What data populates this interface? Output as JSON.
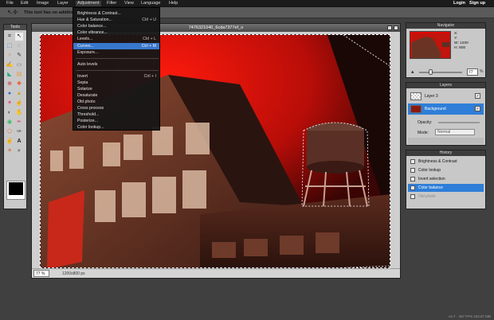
{
  "menubar": {
    "items": [
      "File",
      "Edit",
      "Image",
      "Layer",
      "Adjustment",
      "Filter",
      "View",
      "Language",
      "Help"
    ],
    "login": "Login",
    "signup": "Sign up"
  },
  "optbar": {
    "message": "This tool has no additional options."
  },
  "tools": {
    "title": "Tools"
  },
  "document": {
    "title": "7476321040_6cda7377ef_o",
    "zoom": "77",
    "zoom_unit": "%",
    "dimensions": "1200x800 px"
  },
  "adjustment_menu": {
    "items": [
      {
        "label": "Brightness & Contrast...",
        "shortcut": ""
      },
      {
        "label": "Hue & Saturation...",
        "shortcut": "Ctrl + U"
      },
      {
        "label": "Color balance...",
        "shortcut": ""
      },
      {
        "label": "Color vibrance...",
        "shortcut": ""
      },
      {
        "label": "Levels...",
        "shortcut": "Ctrl + L"
      },
      {
        "label": "Curves...",
        "shortcut": "Ctrl + M"
      },
      {
        "label": "Exposure...",
        "shortcut": ""
      },
      {
        "label": "Auto levels",
        "shortcut": ""
      },
      {
        "label": "Invert",
        "shortcut": "Ctrl + I"
      },
      {
        "label": "Sepia",
        "shortcut": ""
      },
      {
        "label": "Solarize",
        "shortcut": ""
      },
      {
        "label": "Desaturate",
        "shortcut": ""
      },
      {
        "label": "Old photo",
        "shortcut": ""
      },
      {
        "label": "Cross process",
        "shortcut": ""
      },
      {
        "label": "Threshold...",
        "shortcut": ""
      },
      {
        "label": "Posterize...",
        "shortcut": ""
      },
      {
        "label": "Color lookup...",
        "shortcut": ""
      }
    ],
    "highlighted_index": 5
  },
  "navigator": {
    "title": "Navigator",
    "x_label": "X:",
    "y_label": "Y:",
    "w_label": "W:",
    "w_value": "1200",
    "h_label": "H:",
    "h_value": "800",
    "zoom": "77",
    "zoom_unit": "%"
  },
  "layers": {
    "title": "Layers",
    "items": [
      {
        "name": "Layer 3",
        "selected": false
      },
      {
        "name": "Background",
        "selected": true
      }
    ],
    "opacity_label": "Opacity:",
    "mode_label": "Mode:",
    "mode_value": "Normal"
  },
  "history": {
    "title": "History",
    "items": [
      {
        "label": "Brightness & Contrast",
        "state": "normal"
      },
      {
        "label": "Color lookup",
        "state": "normal"
      },
      {
        "label": "Invert selection",
        "state": "normal"
      },
      {
        "label": "Color balance",
        "state": "selected"
      },
      {
        "label": "Old photo",
        "state": "dim"
      }
    ]
  },
  "footer": {
    "version": "v4.7 · 467 FPS 233.87 MB"
  },
  "colors": {
    "accent": "#2f7ed8",
    "menubar": "#1c1c1c",
    "workspace": "#404040"
  }
}
